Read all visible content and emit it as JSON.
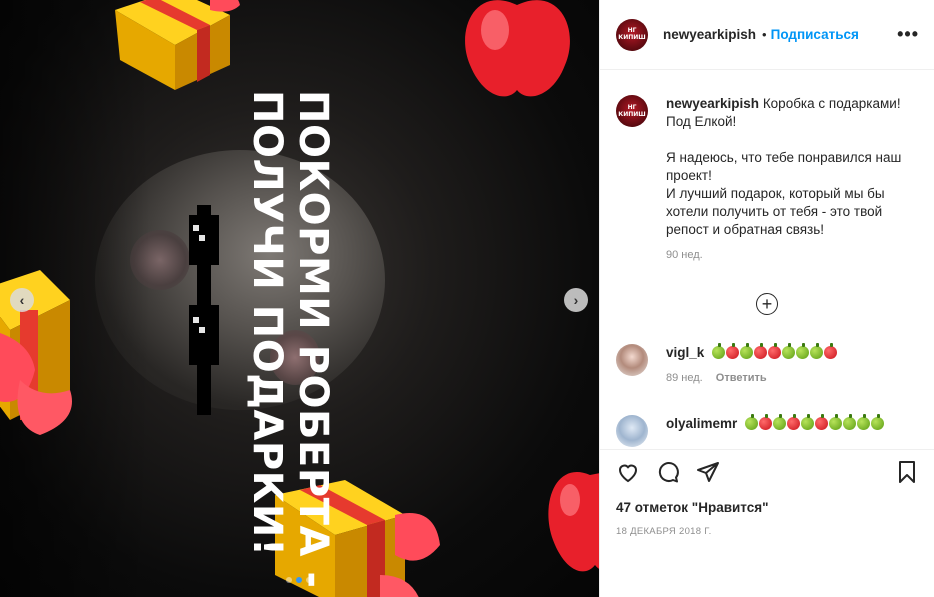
{
  "media": {
    "overlay_text_line1": "ПОКОРМИ РОБЕРТА -",
    "overlay_text_line2": "ПОЛУЧИ ПОДАРКИ!",
    "carousel_total": 3,
    "carousel_active_index": 2,
    "prev_icon": "chevron-left-icon",
    "next_icon": "chevron-right-icon"
  },
  "header": {
    "avatar_text_1": "НГ",
    "avatar_text_2": "КИПИШ",
    "username": "newyearkipish",
    "separator": "•",
    "follow_label": "Подписаться",
    "more_icon": "more-horizontal-icon",
    "more_label": "•••"
  },
  "caption": {
    "avatar_text_1": "НГ",
    "avatar_text_2": "КИПИШ",
    "username": "newyearkipish",
    "text": "Коробка с подарками! Под Елкой!\n\nЯ надеюсь, что тебе понравился наш проект!\nИ лучший подарок, который мы бы хотели получить от тебя - это твой репост и обратная связь!",
    "time": "90 нед.",
    "load_more_label": "+"
  },
  "comments": [
    {
      "username": "vigl_k",
      "fruits": [
        "g",
        "r",
        "g",
        "r",
        "r",
        "g",
        "g",
        "g",
        "r"
      ],
      "time": "89 нед.",
      "reply_label": "Ответить"
    },
    {
      "username": "olyalimemr",
      "fruits": [
        "g",
        "r",
        "g",
        "r",
        "g",
        "r",
        "g",
        "g",
        "g",
        "g"
      ],
      "time": "",
      "reply_label": ""
    }
  ],
  "actions": {
    "like_icon": "heart-icon",
    "comment_icon": "comment-icon",
    "share_icon": "share-icon",
    "save_icon": "bookmark-icon",
    "likes_text": "47 отметок \"Нравится\"",
    "date": "18 ДЕКАБРЯ 2018 Г."
  },
  "colors": {
    "accent": "#0095f6",
    "text": "#262626",
    "muted": "#8e8e8e",
    "carousel_active_dot": "#3897f0"
  }
}
